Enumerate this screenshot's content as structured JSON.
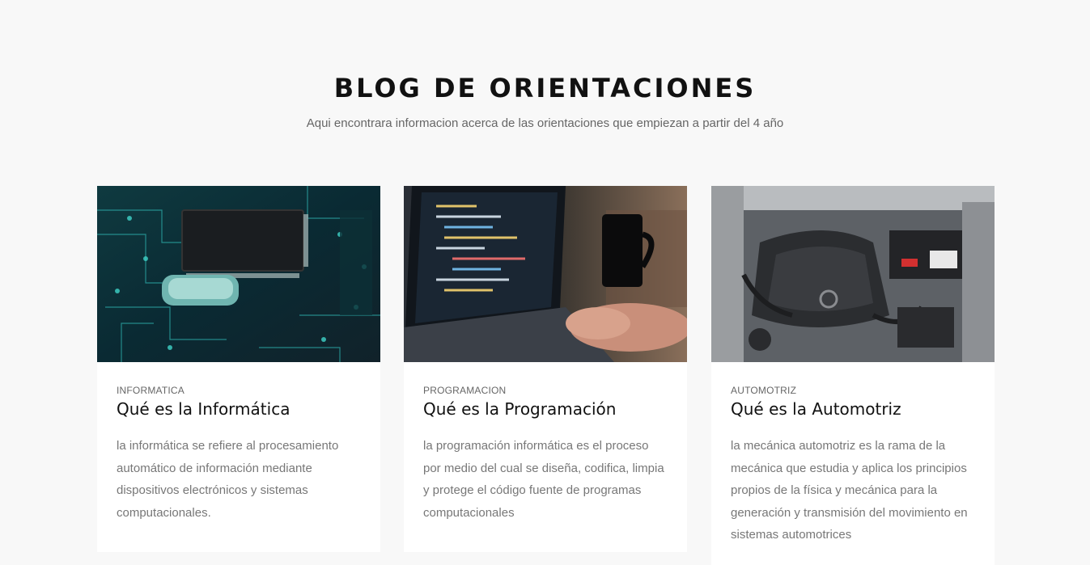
{
  "section": {
    "title": "BLOG DE ORIENTACIONES",
    "subtitle": "Aqui encontrara informacion acerca de las orientaciones que empiezan a partir del 4 año"
  },
  "cards": [
    {
      "image_icon": "circuit-board-image",
      "category": "INFORMATICA",
      "title": "Qué es la Informática",
      "text": "la informática se refiere al procesamiento automático de información mediante dispositivos electrónicos y sistemas computacionales."
    },
    {
      "image_icon": "laptop-code-image",
      "category": "PROGRAMACION",
      "title": "Qué es la Programación",
      "text": "la programación informática es el proceso por medio del cual se diseña, codifica, limpia y protege el código fuente de programas computacionales"
    },
    {
      "image_icon": "car-engine-image",
      "category": "AUTOMOTRIZ",
      "title": "Qué es la Automotriz",
      "text": "la mecánica automotriz es la rama de la mecánica que estudia y aplica los principios propios de la física y mecánica para la generación y transmisión del movimiento en sistemas automotrices"
    }
  ],
  "colors": {
    "background": "#f8f8f8",
    "card": "#ffffff",
    "heading": "#111111",
    "muted": "#777777"
  }
}
